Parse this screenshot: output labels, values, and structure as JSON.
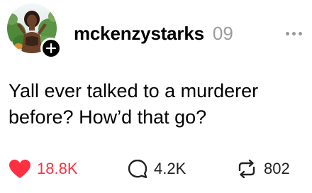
{
  "post": {
    "author": {
      "username": "mckenzystarks",
      "avatar_icon": "profile-photo",
      "follow_icon": "plus-icon"
    },
    "timestamp": "09",
    "more_icon": "more-horizontal-icon",
    "text": "Yall ever talked to a murderer before? How’d that go?",
    "stats": {
      "likes": "18.8K",
      "replies": "4.2K",
      "reposts": "802"
    },
    "colors": {
      "like_accent": "#ff3040",
      "muted": "#9a9a9a",
      "text": "#000000"
    }
  }
}
